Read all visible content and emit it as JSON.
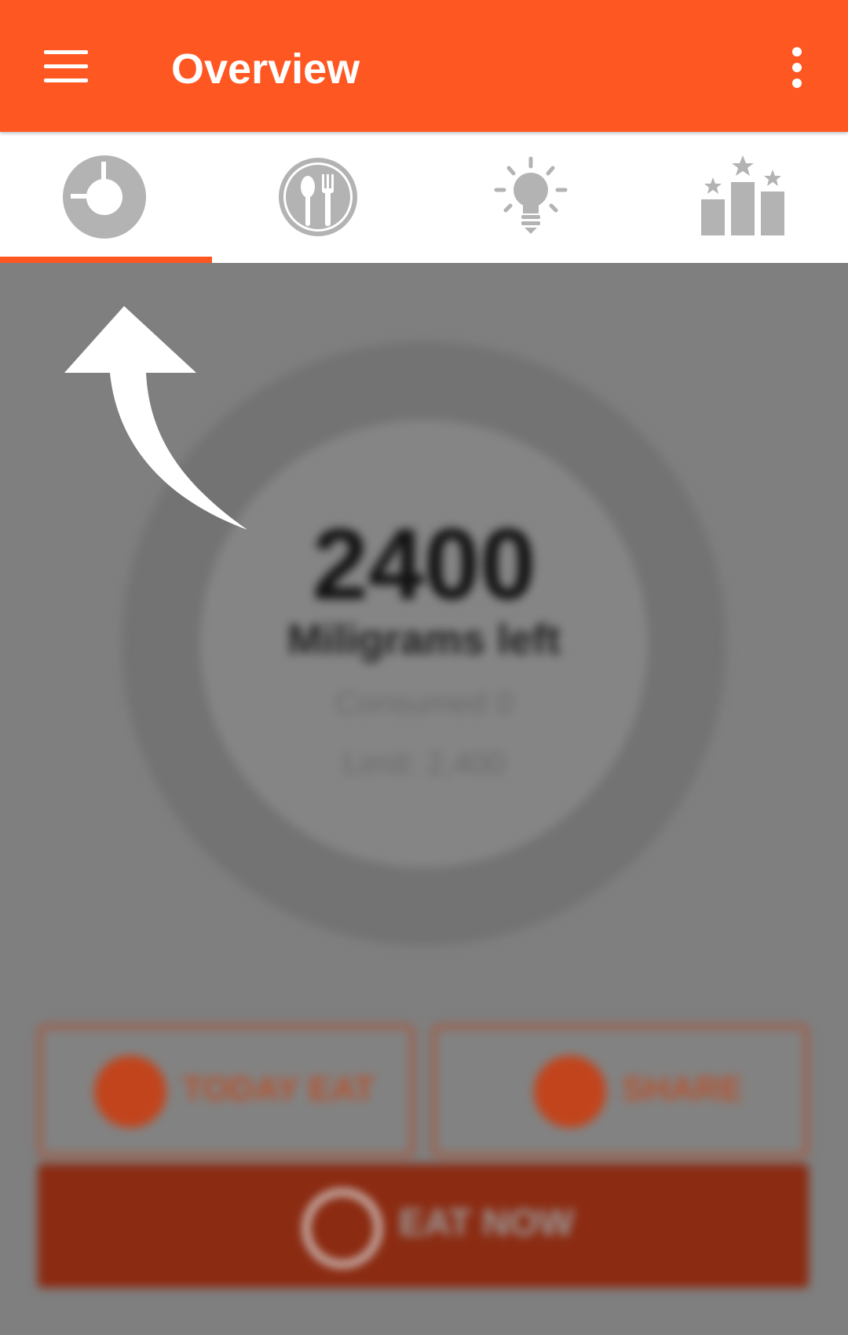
{
  "app_bar": {
    "title": "Overview",
    "menu_icon": "hamburger-menu-icon",
    "overflow_icon": "more-vert-icon"
  },
  "tabs": [
    {
      "icon": "donut-chart-icon",
      "selected": true
    },
    {
      "icon": "spoon-fork-plate-icon",
      "selected": false
    },
    {
      "icon": "lightbulb-icon",
      "selected": false
    },
    {
      "icon": "podium-stars-icon",
      "selected": false
    }
  ],
  "summary": {
    "amount_left": "2400",
    "unit_label": "Miligrams left",
    "consumed": "Consumed 0",
    "limit": "Limit: 2,400"
  },
  "actions": {
    "today_eat": "TODAY EAT",
    "share": "SHARE",
    "eat_now": "EAT NOW"
  },
  "colors": {
    "primary": "#ff5722",
    "tab_icon": "#b3b3b3",
    "overlay": "#7f7f7f"
  },
  "coach_mark_icon": "curved-arrow-up-icon"
}
